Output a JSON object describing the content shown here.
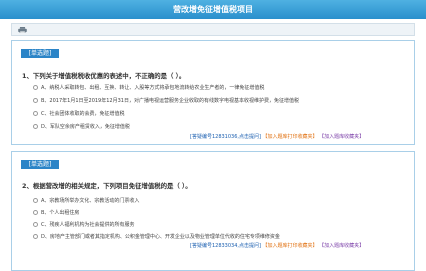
{
  "header": {
    "title": "营改增免征增值税项目"
  },
  "questions": [
    {
      "tag": "[单选题]",
      "number": "1、",
      "text": "下列关于增值税税收优惠的表述中，不正确的是（  ）。",
      "options": [
        "A、纳税人采取转包、出租、互换、转让、入股等方式将承包地流转给农业生产者的，一律免征增值税",
        "B、2017年1月1日至2019年12月31日，对广播电视运营服务企业收取的有线数字电视基本收视维护费，免征增值税",
        "C、社会团体收取的会费，免征增值税",
        "D、军队空余房产租赁收入，免征增值税"
      ],
      "link_id": "[答疑编号12831036,点击提问]",
      "link_print": "【加入题库打印收藏夹】",
      "link_fav": "【加入题库收藏夹】"
    },
    {
      "tag": "[单选题]",
      "number": "2、",
      "text": "根据营改增的相关规定，下列项目免征增值税的是（  ）。",
      "options": [
        "A、宗教场所举办文化、宗教活动的门票收入",
        "B、个人出租住房",
        "C、残疾人福利机构为社会提供的所有服务",
        "D、房地产主管部门或者其指定机构、公积金管理中心、开发企业以及物业管理单位代收的住宅专项维修资金"
      ],
      "link_id": "[答疑编号12833034,点击提问]",
      "link_print": "【加入题库打印收藏夹】",
      "link_fav": "【加入题库收藏夹】"
    }
  ],
  "icons": {
    "print": "printer-icon"
  },
  "colors": {
    "header": "#3aa0d8",
    "tag": "#2b84c7",
    "link_blue": "#1b5fb0",
    "link_orange": "#e1700f",
    "link_purple": "#7b3fa8"
  }
}
